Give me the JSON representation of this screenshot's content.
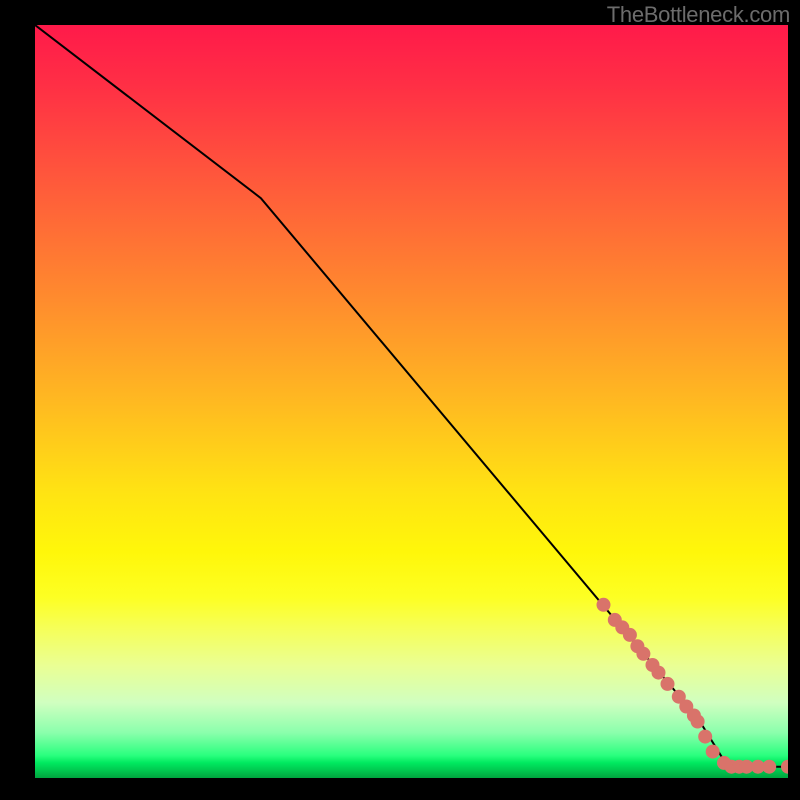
{
  "watermark": "TheBottleneck.com",
  "chart_data": {
    "type": "line",
    "title": "",
    "xlabel": "",
    "ylabel": "",
    "xlim": [
      0,
      100
    ],
    "ylim": [
      0,
      100
    ],
    "line": {
      "x": [
        0,
        30,
        88,
        92,
        100
      ],
      "y": [
        100,
        77,
        8,
        1.5,
        1.5
      ]
    },
    "points": [
      {
        "x": 75.5,
        "y": 23
      },
      {
        "x": 77.0,
        "y": 21
      },
      {
        "x": 78.0,
        "y": 20
      },
      {
        "x": 79.0,
        "y": 19
      },
      {
        "x": 80.0,
        "y": 17.5
      },
      {
        "x": 80.8,
        "y": 16.5
      },
      {
        "x": 82.0,
        "y": 15
      },
      {
        "x": 82.8,
        "y": 14
      },
      {
        "x": 84.0,
        "y": 12.5
      },
      {
        "x": 85.5,
        "y": 10.8
      },
      {
        "x": 86.5,
        "y": 9.5
      },
      {
        "x": 87.5,
        "y": 8.3
      },
      {
        "x": 88.0,
        "y": 7.5
      },
      {
        "x": 89.0,
        "y": 5.5
      },
      {
        "x": 90.0,
        "y": 3.5
      },
      {
        "x": 91.5,
        "y": 2.0
      },
      {
        "x": 92.5,
        "y": 1.5
      },
      {
        "x": 93.5,
        "y": 1.5
      },
      {
        "x": 94.5,
        "y": 1.5
      },
      {
        "x": 96.0,
        "y": 1.5
      },
      {
        "x": 97.5,
        "y": 1.5
      },
      {
        "x": 100.0,
        "y": 1.5
      }
    ],
    "colors": {
      "line": "#000000",
      "point_fill": "#d9736a",
      "point_stroke": "#b85a52"
    },
    "point_radius": 7,
    "grid": false,
    "legend": false
  }
}
